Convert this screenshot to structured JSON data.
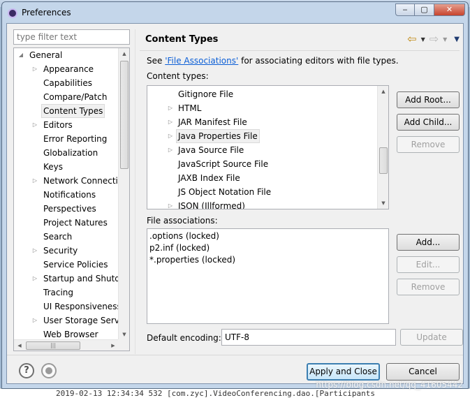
{
  "window": {
    "title": "Preferences",
    "minimize_glyph": "‒",
    "maximize_glyph": "▢",
    "close_glyph": "✕"
  },
  "filter": {
    "placeholder": "type filter text",
    "value": ""
  },
  "tree": {
    "items": [
      {
        "label": "General",
        "level": 0,
        "expander": "expanded"
      },
      {
        "label": "Appearance",
        "level": 1,
        "expander": "collapsed"
      },
      {
        "label": "Capabilities",
        "level": 1,
        "expander": "none"
      },
      {
        "label": "Compare/Patch",
        "level": 1,
        "expander": "none"
      },
      {
        "label": "Content Types",
        "level": 1,
        "expander": "none",
        "selected": true
      },
      {
        "label": "Editors",
        "level": 1,
        "expander": "collapsed"
      },
      {
        "label": "Error Reporting",
        "level": 1,
        "expander": "none"
      },
      {
        "label": "Globalization",
        "level": 1,
        "expander": "none"
      },
      {
        "label": "Keys",
        "level": 1,
        "expander": "none"
      },
      {
        "label": "Network Connectio",
        "level": 1,
        "expander": "collapsed"
      },
      {
        "label": "Notifications",
        "level": 1,
        "expander": "none"
      },
      {
        "label": "Perspectives",
        "level": 1,
        "expander": "none"
      },
      {
        "label": "Project Natures",
        "level": 1,
        "expander": "none"
      },
      {
        "label": "Search",
        "level": 1,
        "expander": "none"
      },
      {
        "label": "Security",
        "level": 1,
        "expander": "collapsed"
      },
      {
        "label": "Service Policies",
        "level": 1,
        "expander": "none"
      },
      {
        "label": "Startup and Shutd",
        "level": 1,
        "expander": "collapsed"
      },
      {
        "label": "Tracing",
        "level": 1,
        "expander": "none"
      },
      {
        "label": "UI Responsiveness",
        "level": 1,
        "expander": "none"
      },
      {
        "label": "User Storage Serv",
        "level": 1,
        "expander": "collapsed"
      },
      {
        "label": "Web Browser",
        "level": 1,
        "expander": "none"
      }
    ]
  },
  "page": {
    "title": "Content Types",
    "description_prefix": "See ",
    "description_link": "'File Associations'",
    "description_suffix": " for associating editors with file types.",
    "content_types_label": "Content types:",
    "content_types": [
      {
        "label": "Gitignore File",
        "expander": "none"
      },
      {
        "label": "HTML",
        "expander": "collapsed"
      },
      {
        "label": "JAR Manifest File",
        "expander": "collapsed"
      },
      {
        "label": "Java Properties File",
        "expander": "collapsed",
        "selected": true
      },
      {
        "label": "Java Source File",
        "expander": "collapsed"
      },
      {
        "label": "JavaScript Source File",
        "expander": "none"
      },
      {
        "label": "JAXB Index File",
        "expander": "none"
      },
      {
        "label": "JS Object Notation File",
        "expander": "none"
      },
      {
        "label": "JSON (Illformed)",
        "expander": "collapsed"
      }
    ],
    "file_associations_label": "File associations:",
    "file_associations": [
      ".options (locked)",
      "p2.inf (locked)",
      "*.properties (locked)"
    ],
    "encoding_label": "Default encoding:",
    "encoding_value": "UTF-8"
  },
  "buttons": {
    "add_root": "Add Root...",
    "add_child": "Add Child...",
    "remove_type": "Remove",
    "add_assoc": "Add...",
    "edit_assoc": "Edit...",
    "remove_assoc": "Remove",
    "update": "Update",
    "apply_close": "Apply and Close",
    "cancel": "Cancel"
  },
  "background": {
    "console_text": "2019-02-13 12:34:34 532 [com.zyc].VideoConferencing.dao.[Participants",
    "watermark": "https://blog.csdn.net/qq_41605442"
  },
  "colors": {
    "link": "#0b5ed6",
    "back_arrow": "#c08a13",
    "default_button_border": "#3c7fb1"
  }
}
